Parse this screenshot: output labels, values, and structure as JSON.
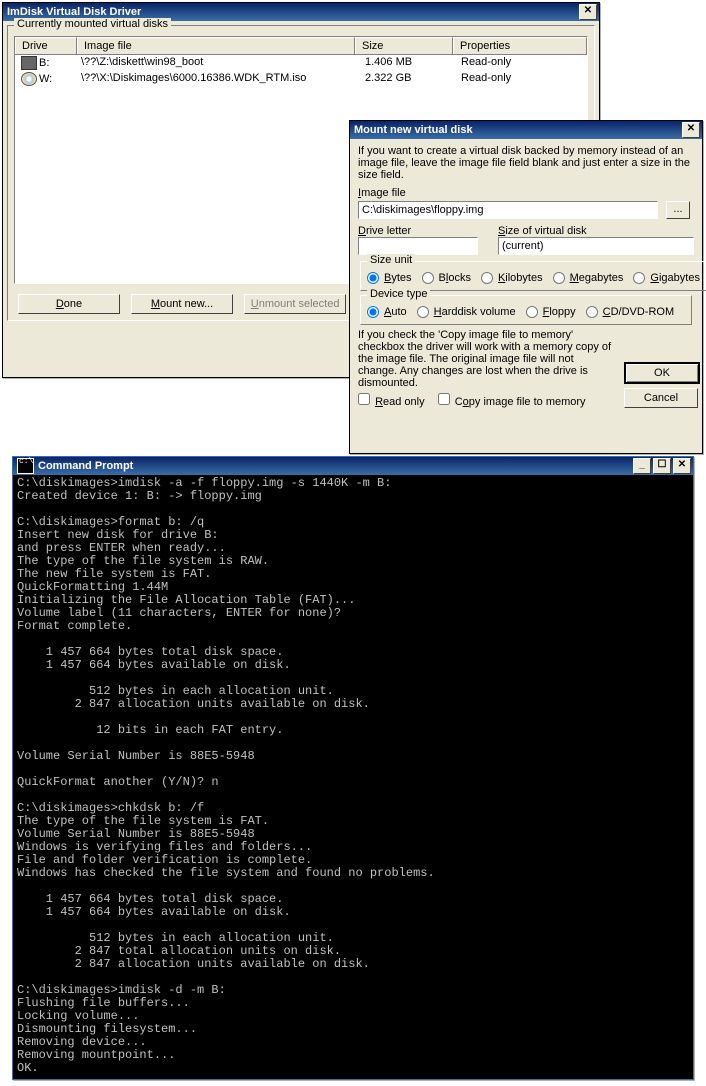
{
  "main": {
    "title": "ImDisk Virtual Disk Driver",
    "group_label": "Currently mounted virtual disks",
    "headers": {
      "drive": "Drive",
      "image": "Image file",
      "size": "Size",
      "prop": "Properties"
    },
    "rows": [
      {
        "icon": "floppy",
        "drive": "B:",
        "image": "\\??\\Z:\\diskett\\win98_boot",
        "size": "1.406 MB",
        "prop": "Read-only"
      },
      {
        "icon": "cd",
        "drive": "W:",
        "image": "\\??\\X:\\Diskimages\\6000.16386.WDK_RTM.iso",
        "size": "2.322 GB",
        "prop": "Read-only"
      }
    ],
    "buttons": {
      "done": "Done",
      "mount": "Mount new...",
      "unmount": "Unmount selected"
    }
  },
  "mount": {
    "title": "Mount new virtual disk",
    "hint": "If you want to create a virtual disk backed by memory instead of an image file, leave the image file field blank and just enter a size in the size field.",
    "image_label": "Image file",
    "image_value": "C:\\diskimages\\floppy.img",
    "browse_btn": "...",
    "drive_label": "Drive letter",
    "drive_value": "",
    "size_label": "Size of virtual disk",
    "size_value": "(current)",
    "sizeunit_legend": "Size unit",
    "units": {
      "b": "Bytes",
      "bl": "Blocks",
      "k": "Kilobytes",
      "m": "Megabytes",
      "g": "Gigabytes"
    },
    "device_legend": "Device type",
    "devices": {
      "a": "Auto",
      "h": "Harddisk volume",
      "f": "Floppy",
      "c": "CD/DVD-ROM"
    },
    "copy_hint": "If you check the 'Copy image file to memory' checkbox the driver will work with a memory copy of the image file. The original image file will not change. Any changes are lost when the drive is dismounted.",
    "read_only": "Read only",
    "copy_mem": "Copy image file to memory",
    "ok": "OK",
    "cancel": "Cancel"
  },
  "cmd": {
    "title": "Command Prompt",
    "text": "C:\\diskimages>imdisk -a -f floppy.img -s 1440K -m B:\nCreated device 1: B: -> floppy.img\n\nC:\\diskimages>format b: /q\nInsert new disk for drive B:\nand press ENTER when ready...\nThe type of the file system is RAW.\nThe new file system is FAT.\nQuickFormatting 1.44M\nInitializing the File Allocation Table (FAT)...\nVolume label (11 characters, ENTER for none)?\nFormat complete.\n\n    1 457 664 bytes total disk space.\n    1 457 664 bytes available on disk.\n\n          512 bytes in each allocation unit.\n        2 847 allocation units available on disk.\n\n           12 bits in each FAT entry.\n\nVolume Serial Number is 88E5-5948\n\nQuickFormat another (Y/N)? n\n\nC:\\diskimages>chkdsk b: /f\nThe type of the file system is FAT.\nVolume Serial Number is 88E5-5948\nWindows is verifying files and folders...\nFile and folder verification is complete.\nWindows has checked the file system and found no problems.\n\n    1 457 664 bytes total disk space.\n    1 457 664 bytes available on disk.\n\n          512 bytes in each allocation unit.\n        2 847 total allocation units on disk.\n        2 847 allocation units available on disk.\n\nC:\\diskimages>imdisk -d -m B:\nFlushing file buffers...\nLocking volume...\nDismounting filesystem...\nRemoving device...\nRemoving mountpoint...\nOK.\n\nC:\\diskimages>_"
  }
}
